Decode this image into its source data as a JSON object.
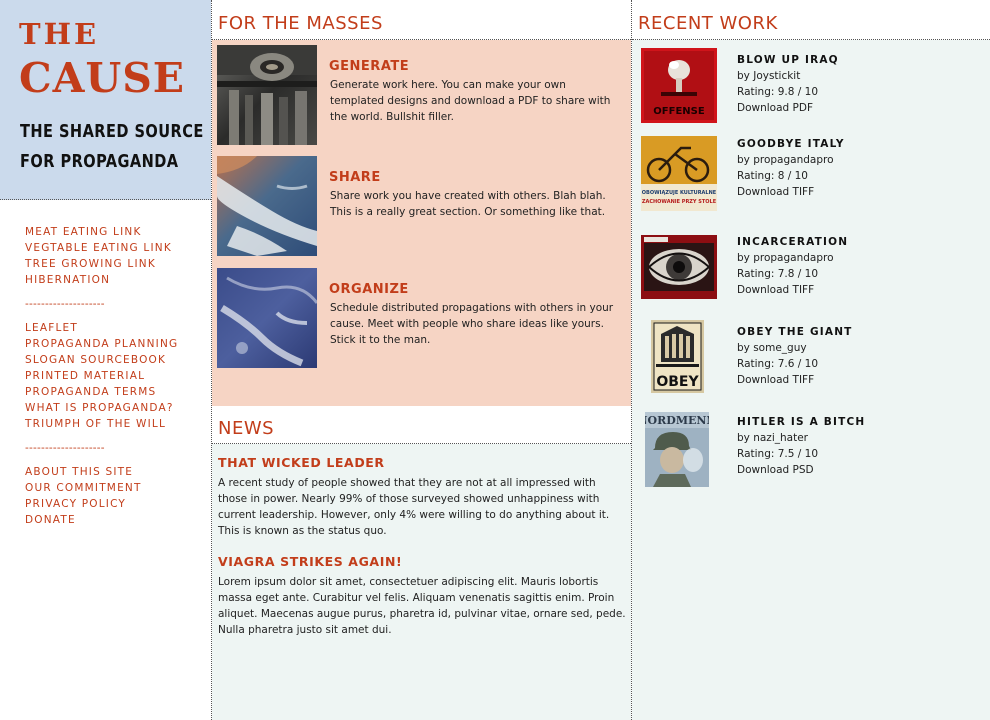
{
  "brand": {
    "line1": "THE",
    "line2": "CAUSE",
    "tagline1": "THE SHARED SOURCE",
    "tagline2": "FOR PROPAGANDA"
  },
  "nav": {
    "group1": [
      "MEAT EATING LINK",
      "VEGTABLE EATING LINK",
      "TREE GROWING LINK",
      "HIBERNATION"
    ],
    "separator": "--------------------",
    "group2": [
      "LEAFLET",
      "PROPAGANDA PLANNING",
      "SLOGAN SOURCEBOOK",
      "PRINTED MATERIAL",
      "PROPAGANDA TERMS",
      "WHAT IS PROPAGANDA?",
      "TRIUMPH OF THE WILL"
    ],
    "group3": [
      "ABOUT THIS SITE",
      "OUR COMMITMENT",
      "PRIVACY POLICY",
      "DONATE"
    ]
  },
  "masses": {
    "heading": "FOR THE MASSES",
    "items": [
      {
        "title": "GENERATE",
        "desc": "Generate work here.  You can make your own templated designs and download a PDF to share with the world.  Bullshit filler.",
        "icon": "gears-photo"
      },
      {
        "title": "SHARE",
        "desc": "Share work you have created with others.  Blah blah.  This is a really great section.  Or something like that.",
        "icon": "earth-photo"
      },
      {
        "title": "ORGANIZE",
        "desc": "Schedule distributed propagations with others in your cause.  Meet with people who share ideas like yours.  Stick it to the man.",
        "icon": "marble-photo"
      }
    ]
  },
  "news": {
    "heading": "NEWS",
    "items": [
      {
        "title": "THAT WICKED LEADER",
        "body": "A recent study of people showed that they are not at all impressed with those in power.  Nearly 99% of those surveyed showed unhappiness with current leadership.  However, only 4% were willing to do anything about it.  This is known as the status quo."
      },
      {
        "title": "VIAGRA STRIKES AGAIN!",
        "body": "Lorem ipsum dolor sit amet, consectetuer adipiscing elit. Mauris lobortis massa eget ante. Curabitur vel felis. Aliquam venenatis sagittis enim. Proin aliquet. Maecenas augue purus, pharetra id, pulvinar vitae, ornare sed, pede. Nulla pharetra justo sit amet dui."
      }
    ]
  },
  "recent": {
    "heading": "RECENT WORK",
    "items": [
      {
        "title": "BLOW UP IRAQ",
        "by": "by Joystickit",
        "rating": "Rating: 9.8 / 10",
        "download": "Download PDF",
        "poster_text": "OFFENSE"
      },
      {
        "title": "GOODBYE ITALY",
        "by": "by propagandapro",
        "rating": "Rating: 8 / 10",
        "download": "Download TIFF",
        "poster_text": "OBOWIĄZUJE KULTURALNE ZACHOWANIE PRZY STOLE"
      },
      {
        "title": "INCARCERATION",
        "by": "by propagandapro",
        "rating": "Rating: 7.8 / 10",
        "download": "Download TIFF",
        "poster_text": ""
      },
      {
        "title": "OBEY THE GIANT",
        "by": "by some_guy",
        "rating": "Rating: 7.6 / 10",
        "download": "Download TIFF",
        "poster_text": "OBEY"
      },
      {
        "title": "HITLER IS A BITCH",
        "by": "by nazi_hater",
        "rating": "Rating: 7.5 / 10",
        "download": "Download PSD",
        "poster_text": "NORDMENN"
      }
    ]
  },
  "colors": {
    "accent": "#c23d1a",
    "brand_bg": "#cbdaec",
    "masses_bg": "#f6d4c4",
    "content_bg": "#eef5f3"
  }
}
